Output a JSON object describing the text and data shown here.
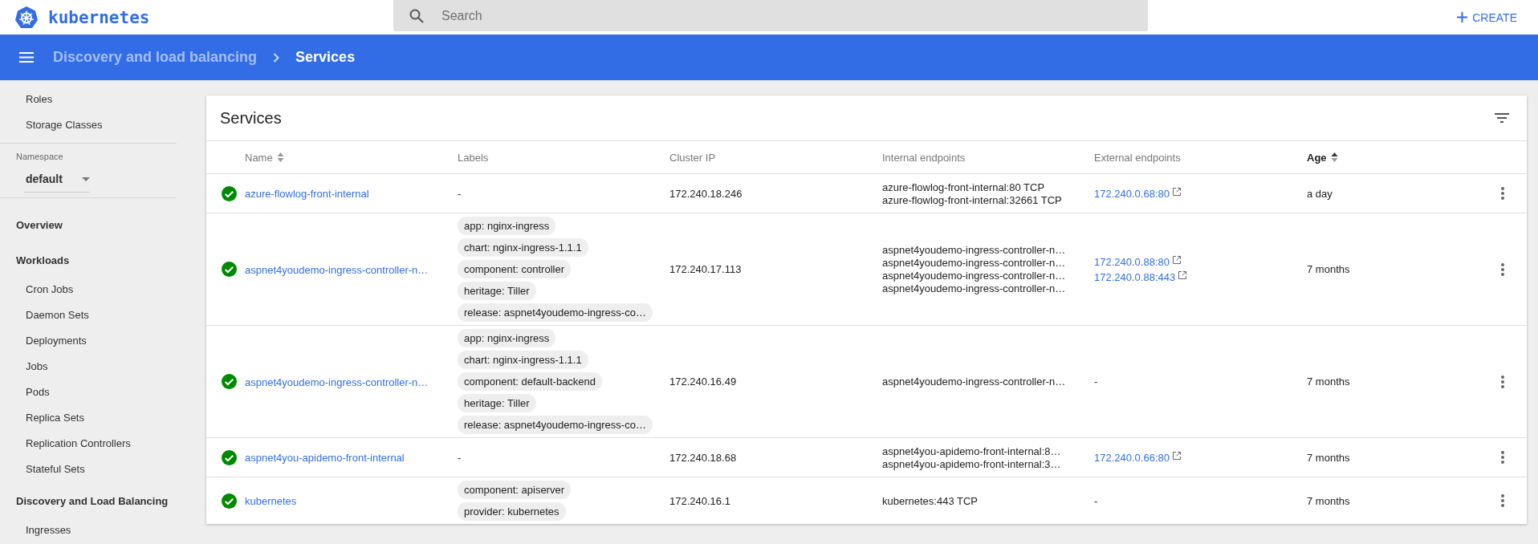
{
  "header": {
    "brand": "kubernetes",
    "search": {
      "placeholder": "Search"
    },
    "create_button": "CREATE"
  },
  "breadcrumb": [
    {
      "label": "Discovery and load balancing",
      "current": false
    },
    {
      "label": "Services",
      "current": true
    }
  ],
  "sidebar": {
    "top_items": [
      "Roles",
      "Storage Classes"
    ],
    "namespace": {
      "label": "Namespace",
      "value": "default"
    },
    "nav": [
      {
        "kind": "heading",
        "label": "Overview"
      },
      {
        "kind": "heading",
        "label": "Workloads"
      },
      {
        "kind": "item",
        "label": "Cron Jobs"
      },
      {
        "kind": "item",
        "label": "Daemon Sets"
      },
      {
        "kind": "item",
        "label": "Deployments"
      },
      {
        "kind": "item",
        "label": "Jobs"
      },
      {
        "kind": "item",
        "label": "Pods"
      },
      {
        "kind": "item",
        "label": "Replica Sets"
      },
      {
        "kind": "item",
        "label": "Replication Controllers"
      },
      {
        "kind": "item",
        "label": "Stateful Sets"
      },
      {
        "kind": "heading",
        "label": "Discovery and Load Balancing"
      },
      {
        "kind": "item",
        "label": "Ingresses"
      }
    ]
  },
  "card": {
    "title": "Services",
    "table": {
      "columns": [
        {
          "label": "Name",
          "sortable": true,
          "sorted": false
        },
        {
          "label": "Labels",
          "sortable": false,
          "sorted": false
        },
        {
          "label": "Cluster IP",
          "sortable": false,
          "sorted": false
        },
        {
          "label": "Internal endpoints",
          "sortable": false,
          "sorted": false
        },
        {
          "label": "External endpoints",
          "sortable": false,
          "sorted": false
        },
        {
          "label": "Age",
          "sortable": true,
          "sorted": true
        }
      ],
      "rows": [
        {
          "healthy": true,
          "name": "azure-flowlog-front-internal",
          "labels": {
            "kind": "text",
            "text": "-"
          },
          "cluster_ip": "172.240.18.246",
          "internal": [
            "azure-flowlog-front-internal:80 TCP",
            "azure-flowlog-front-internal:32661 TCP"
          ],
          "external": [
            {
              "kind": "link",
              "text": "172.240.0.68:80"
            }
          ],
          "age": "a day"
        },
        {
          "healthy": true,
          "name": "aspnet4youdemo-ingress-controller-n…",
          "labels": {
            "kind": "chips",
            "items": [
              "app: nginx-ingress",
              "chart: nginx-ingress-1.1.1",
              "component: controller",
              "heritage: Tiller",
              "release: aspnet4youdemo-ingress-co…"
            ]
          },
          "cluster_ip": "172.240.17.113",
          "internal": [
            "aspnet4youdemo-ingress-controller-n…",
            "aspnet4youdemo-ingress-controller-n…",
            "aspnet4youdemo-ingress-controller-n…",
            "aspnet4youdemo-ingress-controller-n…"
          ],
          "external": [
            {
              "kind": "link",
              "text": "172.240.0.88:80"
            },
            {
              "kind": "link",
              "text": "172.240.0.88:443"
            }
          ],
          "age": "7 months"
        },
        {
          "healthy": true,
          "name": "aspnet4youdemo-ingress-controller-n…",
          "labels": {
            "kind": "chips",
            "items": [
              "app: nginx-ingress",
              "chart: nginx-ingress-1.1.1",
              "component: default-backend",
              "heritage: Tiller",
              "release: aspnet4youdemo-ingress-co…"
            ]
          },
          "cluster_ip": "172.240.16.49",
          "internal": [
            "aspnet4youdemo-ingress-controller-n…"
          ],
          "external": [
            {
              "kind": "text",
              "text": "-"
            }
          ],
          "age": "7 months"
        },
        {
          "healthy": true,
          "name": "aspnet4you-apidemo-front-internal",
          "labels": {
            "kind": "text",
            "text": "-"
          },
          "cluster_ip": "172.240.18.68",
          "internal": [
            "aspnet4you-apidemo-front-internal:8…",
            "aspnet4you-apidemo-front-internal:3…"
          ],
          "external": [
            {
              "kind": "link",
              "text": "172.240.0.66:80"
            }
          ],
          "age": "7 months"
        },
        {
          "healthy": true,
          "name": "kubernetes",
          "labels": {
            "kind": "chips",
            "items": [
              "component: apiserver",
              "provider: kubernetes"
            ]
          },
          "cluster_ip": "172.240.16.1",
          "internal": [
            "kubernetes:443 TCP"
          ],
          "external": [
            {
              "kind": "text",
              "text": "-"
            }
          ],
          "age": "7 months"
        }
      ]
    }
  }
}
